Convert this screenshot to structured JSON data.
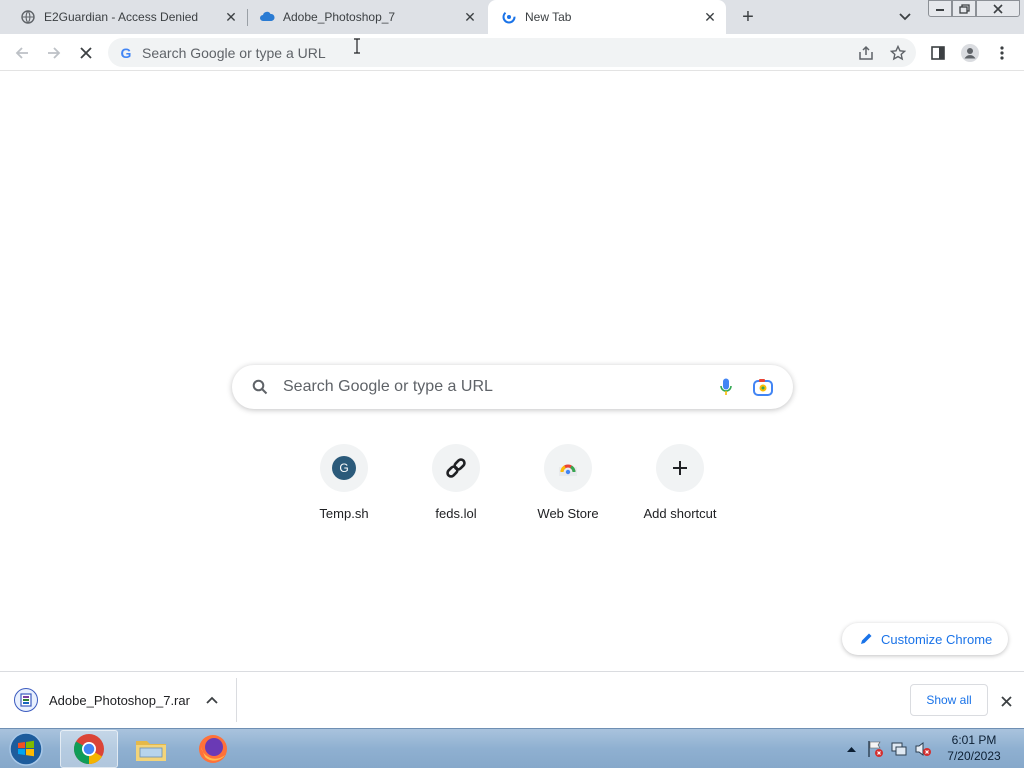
{
  "tabs": [
    {
      "title": "E2Guardian - Access Denied",
      "favicon": "globe-icon",
      "active": false
    },
    {
      "title": "Adobe_Photoshop_7",
      "favicon": "cloud-icon",
      "active": false
    },
    {
      "title": "New Tab",
      "favicon": "chrome-loading-icon",
      "active": true
    }
  ],
  "omnibox": {
    "placeholder": "Search Google or type a URL"
  },
  "ntp": {
    "search_placeholder": "Search Google or type a URL",
    "shortcuts": [
      {
        "label": "Temp.sh",
        "icon": "letter-avatar",
        "letter": "G"
      },
      {
        "label": "feds.lol",
        "icon": "link-icon"
      },
      {
        "label": "Web Store",
        "icon": "web-store-icon"
      },
      {
        "label": "Add shortcut",
        "icon": "plus-icon"
      }
    ],
    "customize_label": "Customize Chrome"
  },
  "download_bar": {
    "file_name": "Adobe_Photoshop_7.rar",
    "show_all_label": "Show all"
  },
  "taskbar": {
    "time": "6:01 PM",
    "date": "7/20/2023"
  },
  "colors": {
    "tabstrip_bg": "#dee1e6",
    "accent_blue": "#1a73e8",
    "taskbar_bg": "#8fb0d1"
  }
}
